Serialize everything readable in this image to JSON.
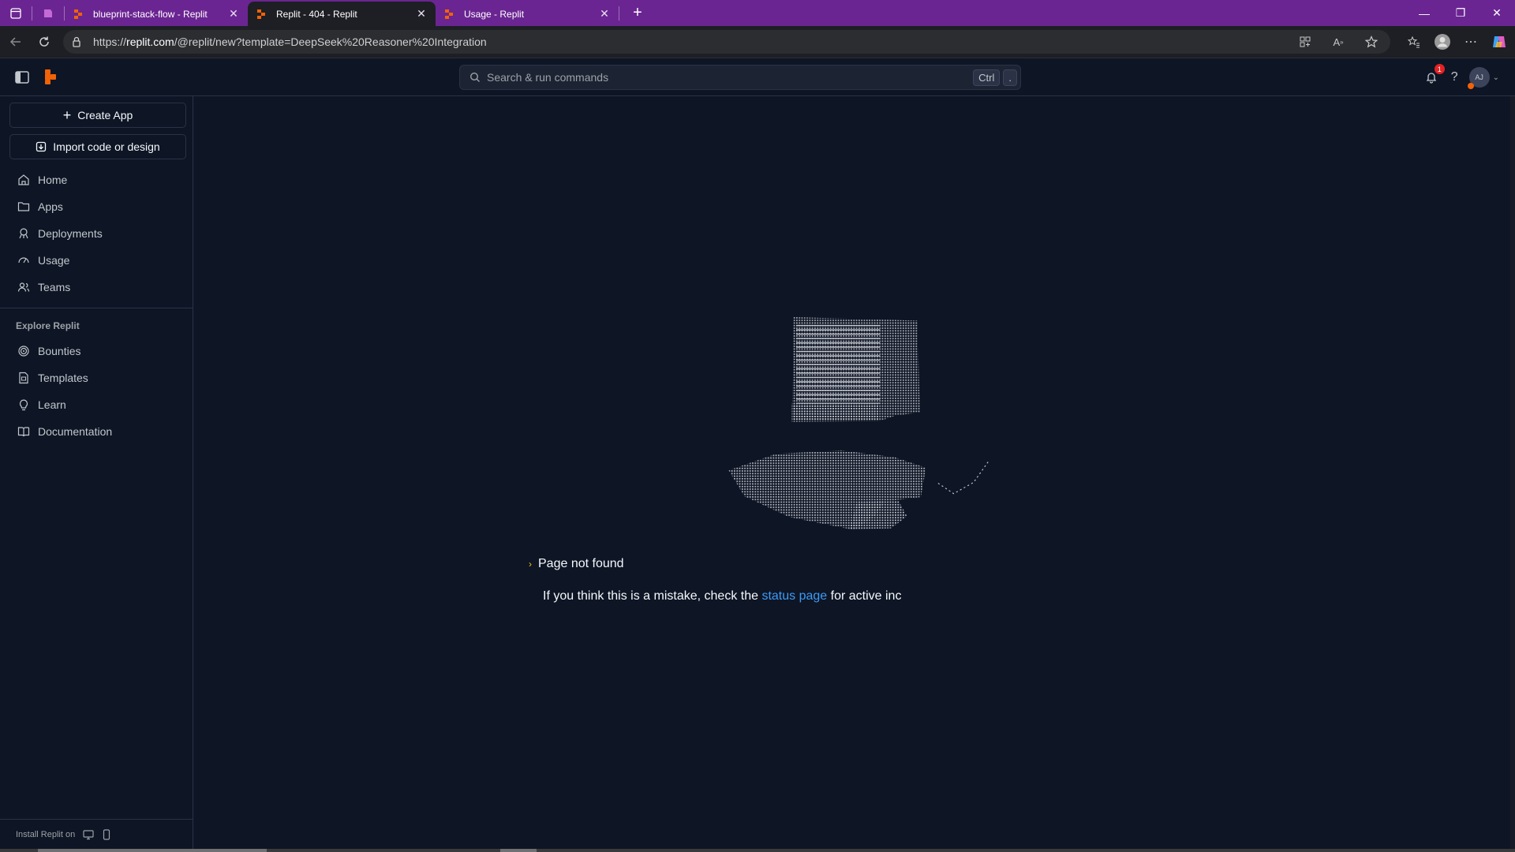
{
  "browser": {
    "tabs": [
      {
        "title": "blueprint-stack-flow - Replit",
        "active": false
      },
      {
        "title": "Replit - 404 - Replit",
        "active": true
      },
      {
        "title": "Usage - Replit",
        "active": false
      }
    ],
    "url_prefix": "https://",
    "url_host": "replit.com",
    "url_path": "/@replit/new?template=DeepSeek%20Reasoner%20Integration"
  },
  "topbar": {
    "search_placeholder": "Search & run commands",
    "kbd_ctrl": "Ctrl",
    "kbd_dot": ".",
    "notification_count": "1",
    "help": "?",
    "avatar_initials": "AJ"
  },
  "sidebar": {
    "create_app": "Create App",
    "import": "Import code or design",
    "nav": [
      {
        "label": "Home",
        "icon": "home-icon"
      },
      {
        "label": "Apps",
        "icon": "folder-icon"
      },
      {
        "label": "Deployments",
        "icon": "deployments-icon"
      },
      {
        "label": "Usage",
        "icon": "usage-icon"
      },
      {
        "label": "Teams",
        "icon": "teams-icon"
      }
    ],
    "explore_heading": "Explore Replit",
    "explore": [
      {
        "label": "Bounties",
        "icon": "bounties-icon"
      },
      {
        "label": "Templates",
        "icon": "templates-icon"
      },
      {
        "label": "Learn",
        "icon": "lightbulb-icon"
      },
      {
        "label": "Documentation",
        "icon": "book-icon"
      }
    ],
    "install_label": "Install Replit on"
  },
  "main": {
    "not_found": "Page not found",
    "mistake_prefix": "If you think this is a mistake, check the ",
    "status_link": "status page",
    "mistake_suffix": " for active inc"
  },
  "colors": {
    "tabstrip": "#6b2592",
    "background": "#0e1525",
    "accent_orange": "#f26207",
    "link_blue": "#3d9bf5",
    "arrow_yellow": "#f2c21b"
  }
}
